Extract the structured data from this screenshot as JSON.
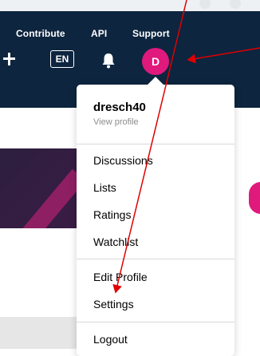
{
  "navbar": {
    "links": [
      "Contribute",
      "API",
      "Support"
    ],
    "language": "EN",
    "avatar_initial": "D",
    "accent": "#e0197c",
    "background": "#0d253f"
  },
  "menu": {
    "username": "dresch40",
    "view_profile": "View profile",
    "group1": [
      "Discussions",
      "Lists",
      "Ratings",
      "Watchlist"
    ],
    "group2": [
      "Edit Profile",
      "Settings"
    ],
    "group3": [
      "Logout"
    ]
  },
  "icons": {
    "add": "plus-icon",
    "notifications": "bell-icon"
  },
  "annotation_color": "#e00000"
}
